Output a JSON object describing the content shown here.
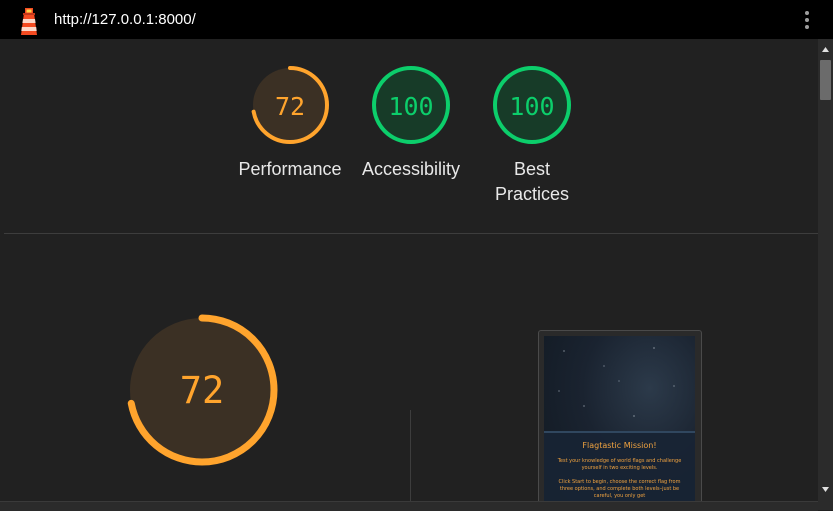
{
  "browser": {
    "url": "http://127.0.0.1:8000/"
  },
  "summary": [
    {
      "score": "72",
      "label": "Performance",
      "status": "average"
    },
    {
      "score": "100",
      "label": "Accessibility",
      "status": "pass"
    },
    {
      "score": "100",
      "label": "Best Practices",
      "status": "pass"
    }
  ],
  "main_gauge": {
    "score": "72",
    "status": "average"
  },
  "screenshot": {
    "title": "Flagtastic Mission!",
    "para1": "Test your knowledge of world flags and challenge yourself in two exciting levels.",
    "para2": "Click Start to begin, choose the correct flag from three options, and complete both levels–just be careful, you only get"
  },
  "colors": {
    "average": "#ffa42d",
    "pass": "#0cce6b",
    "average_bg": "#3b3024",
    "pass_bg": "#173b28"
  },
  "icons": {
    "logo": "lighthouse-icon",
    "menu": "more-vert-icon"
  }
}
